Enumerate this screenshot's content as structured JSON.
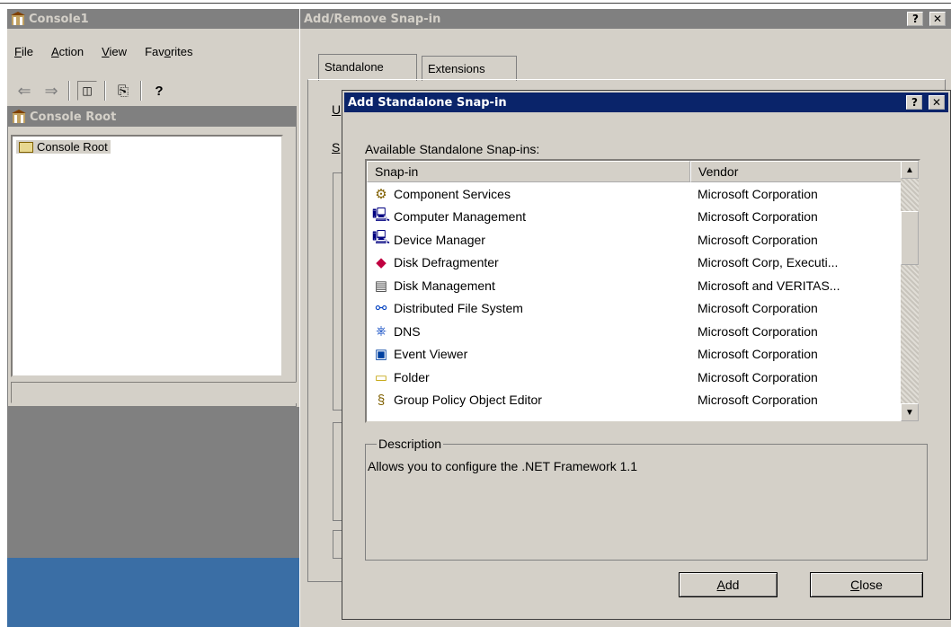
{
  "console": {
    "title": "Console1",
    "menu": [
      "File",
      "Action",
      "View",
      "Favorites"
    ],
    "menu_underline": [
      "F",
      "A",
      "V",
      "o"
    ],
    "tree_title": "Console Root",
    "tree_item": "Console Root"
  },
  "addremove": {
    "title": "Add/Remove Snap-in",
    "tabs": [
      "Standalone",
      "Extensions"
    ],
    "partial_labels": [
      "U",
      "S"
    ]
  },
  "standalone": {
    "title": "Add Standalone Snap-in",
    "available_label": "Available Standalone Snap-ins:",
    "columns": [
      "Snap-in",
      "Vendor"
    ],
    "items": [
      {
        "name": "Component Services",
        "vendor": "Microsoft Corporation",
        "icon": "component-services-icon"
      },
      {
        "name": "Computer Management",
        "vendor": "Microsoft Corporation",
        "icon": "computer-icon"
      },
      {
        "name": "Device Manager",
        "vendor": "Microsoft Corporation",
        "icon": "device-manager-icon"
      },
      {
        "name": "Disk Defragmenter",
        "vendor": "Microsoft Corp, Executi...",
        "icon": "disk-defrag-icon"
      },
      {
        "name": "Disk Management",
        "vendor": "Microsoft and VERITAS...",
        "icon": "disk-management-icon"
      },
      {
        "name": "Distributed File System",
        "vendor": "Microsoft Corporation",
        "icon": "dfs-icon"
      },
      {
        "name": "DNS",
        "vendor": "Microsoft Corporation",
        "icon": "dns-icon"
      },
      {
        "name": "Event Viewer",
        "vendor": "Microsoft Corporation",
        "icon": "event-viewer-icon"
      },
      {
        "name": "Folder",
        "vendor": "Microsoft Corporation",
        "icon": "folder-icon"
      },
      {
        "name": "Group Policy Object Editor",
        "vendor": "Microsoft Corporation",
        "icon": "group-policy-icon"
      }
    ],
    "description_label": "Description",
    "description_text": "Allows you to configure the .NET Framework 1.1",
    "add_button": "Add",
    "close_button": "Close",
    "add_underline": "A",
    "close_underline": "C"
  },
  "colors": {
    "active_title": "#0a246a",
    "inactive_title": "#808080",
    "face": "#d4d0c8",
    "desktop": "#3a6ea5"
  }
}
